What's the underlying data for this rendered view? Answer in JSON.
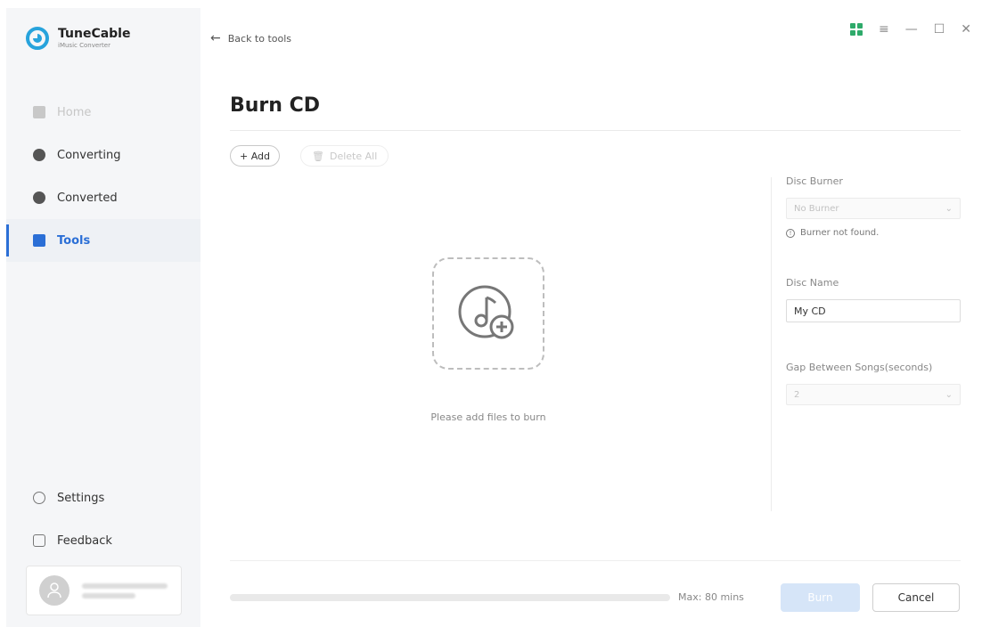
{
  "app": {
    "name": "TuneCable",
    "subtitle": "iMusic Converter"
  },
  "sidebar": {
    "items": [
      {
        "label": "Home",
        "icon": "home-icon",
        "state": "disabled"
      },
      {
        "label": "Converting",
        "icon": "converting-icon",
        "state": "normal"
      },
      {
        "label": "Converted",
        "icon": "converted-icon",
        "state": "normal"
      },
      {
        "label": "Tools",
        "icon": "tools-icon",
        "state": "active"
      }
    ],
    "bottom": [
      {
        "label": "Settings",
        "icon": "settings-icon"
      },
      {
        "label": "Feedback",
        "icon": "feedback-icon"
      }
    ],
    "user": {
      "avatar_icon": "user-avatar-icon"
    }
  },
  "header": {
    "back_label": "Back to tools",
    "back_icon": "arrow-left-icon",
    "window_controls": [
      "grid-view-icon",
      "menu-icon",
      "minimize-icon",
      "maximize-icon",
      "close-icon"
    ]
  },
  "page": {
    "title": "Burn CD",
    "add_label": "+ Add",
    "delete_all_label": "Delete All",
    "drop_hint": "Please add files to burn",
    "drop_icon": "music-add-icon"
  },
  "settings": {
    "disc_burner_label": "Disc Burner",
    "disc_burner_value": "No Burner",
    "burner_warning": "Burner not found.",
    "disc_name_label": "Disc Name",
    "disc_name_value": "My CD",
    "gap_label": "Gap Between Songs(seconds)",
    "gap_value": "2"
  },
  "footer": {
    "max_label": "Max: 80 mins",
    "progress_fraction": 0,
    "burn_label": "Burn",
    "cancel_label": "Cancel"
  },
  "colors": {
    "accent": "#2b6fd6",
    "brand": "#27a3dc",
    "burn_disabled": "#d6e5f8"
  }
}
